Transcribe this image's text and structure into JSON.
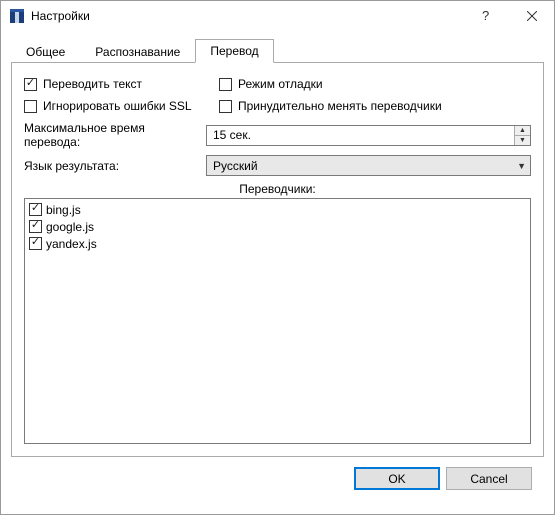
{
  "window": {
    "title": "Настройки"
  },
  "tabs": {
    "general": "Общее",
    "recognition": "Распознавание",
    "translation": "Перевод"
  },
  "checks": {
    "translate_text": "Переводить текст",
    "debug_mode": "Режим отладки",
    "ignore_ssl": "Игнорировать ошибки SSL",
    "force_translators": "Принудительно менять переводчики"
  },
  "fields": {
    "max_time_label": "Максимальное время перевода:",
    "max_time_value": "15 сек.",
    "result_lang_label": "Язык результата:",
    "result_lang_value": "Русский"
  },
  "translators_label": "Переводчики:",
  "translators": {
    "t0": "bing.js",
    "t1": "google.js",
    "t2": "yandex.js"
  },
  "buttons": {
    "ok": "OK",
    "cancel": "Cancel"
  }
}
